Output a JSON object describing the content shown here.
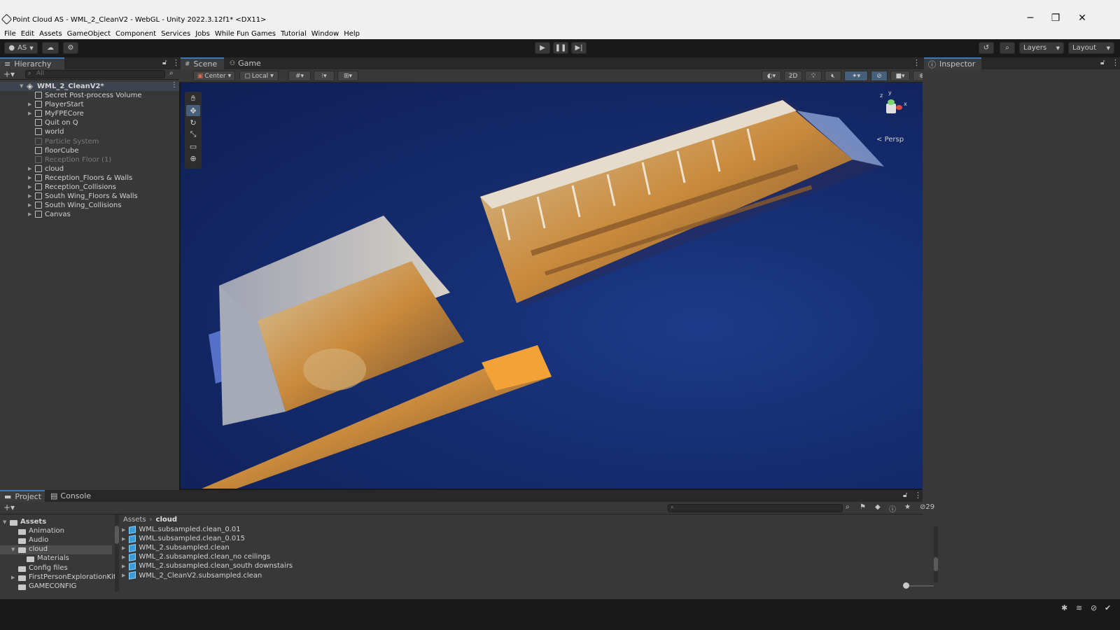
{
  "window": {
    "title": "Point Cloud AS - WML_2_CleanV2 - WebGL - Unity 2022.3.12f1* <DX11>",
    "controls": [
      "─",
      "❐",
      "✕"
    ]
  },
  "menu": [
    "File",
    "Edit",
    "Assets",
    "GameObject",
    "Component",
    "Services",
    "Jobs",
    "While Fun Games",
    "Tutorial",
    "Window",
    "Help"
  ],
  "toolbar": {
    "account_label": "AS",
    "layers_label": "Layers",
    "layout_label": "Layout"
  },
  "hierarchy": {
    "tab_label": "Hierarchy",
    "search_placeholder": "All",
    "scene_name": "WML_2_CleanV2*",
    "items": [
      {
        "label": "Secret Post-process Volume",
        "expandable": false,
        "dim": false
      },
      {
        "label": "PlayerStart",
        "expandable": true,
        "dim": false
      },
      {
        "label": "MyFPECore",
        "expandable": true,
        "dim": false
      },
      {
        "label": "Quit on Q",
        "expandable": false,
        "dim": false
      },
      {
        "label": "world",
        "expandable": false,
        "dim": false
      },
      {
        "label": "Particle System",
        "expandable": false,
        "dim": true
      },
      {
        "label": "floorCube",
        "expandable": false,
        "dim": false
      },
      {
        "label": "Reception Floor (1)",
        "expandable": false,
        "dim": true
      },
      {
        "label": "cloud",
        "expandable": true,
        "dim": false
      },
      {
        "label": "Reception_Floors & Walls",
        "expandable": true,
        "dim": false
      },
      {
        "label": "Reception_Collisions",
        "expandable": true,
        "dim": false
      },
      {
        "label": "South Wing_Floors & Walls",
        "expandable": true,
        "dim": false
      },
      {
        "label": "South Wing_Collisions",
        "expandable": true,
        "dim": false
      },
      {
        "label": "Canvas",
        "expandable": true,
        "dim": false
      }
    ]
  },
  "scene": {
    "tabs": [
      "Scene",
      "Game"
    ],
    "pivot_label": "Center",
    "space_label": "Local",
    "mode_2d": "2D",
    "persp_label": "Persp",
    "gizmo_axes": [
      "y",
      "z",
      "x"
    ]
  },
  "inspector": {
    "tab_label": "Inspector"
  },
  "project": {
    "tabs": [
      "Project",
      "Console"
    ],
    "breadcrumb": [
      "Assets",
      "cloud"
    ],
    "hidden_count": "29",
    "tree": [
      {
        "label": "Assets",
        "indent": 0,
        "bold": true,
        "expanded": true
      },
      {
        "label": "Animation",
        "indent": 1
      },
      {
        "label": "Audio",
        "indent": 1
      },
      {
        "label": "cloud",
        "indent": 1,
        "expanded": true,
        "selected": true
      },
      {
        "label": "Materials",
        "indent": 2
      },
      {
        "label": "Config files",
        "indent": 1
      },
      {
        "label": "FirstPersonExplorationKit",
        "indent": 1,
        "expandable": true
      },
      {
        "label": "GAMECONFIG",
        "indent": 1
      }
    ],
    "assets": [
      "WML.subsampled.clean_0.01",
      "WML.subsampled.clean_0.015",
      "WML_2.subsampled.clean",
      "WML_2.subsampled.clean_no ceilings",
      "WML_2.subsampled.clean_south downstairs",
      "WML_2_CleanV2.subsampled.clean"
    ]
  }
}
